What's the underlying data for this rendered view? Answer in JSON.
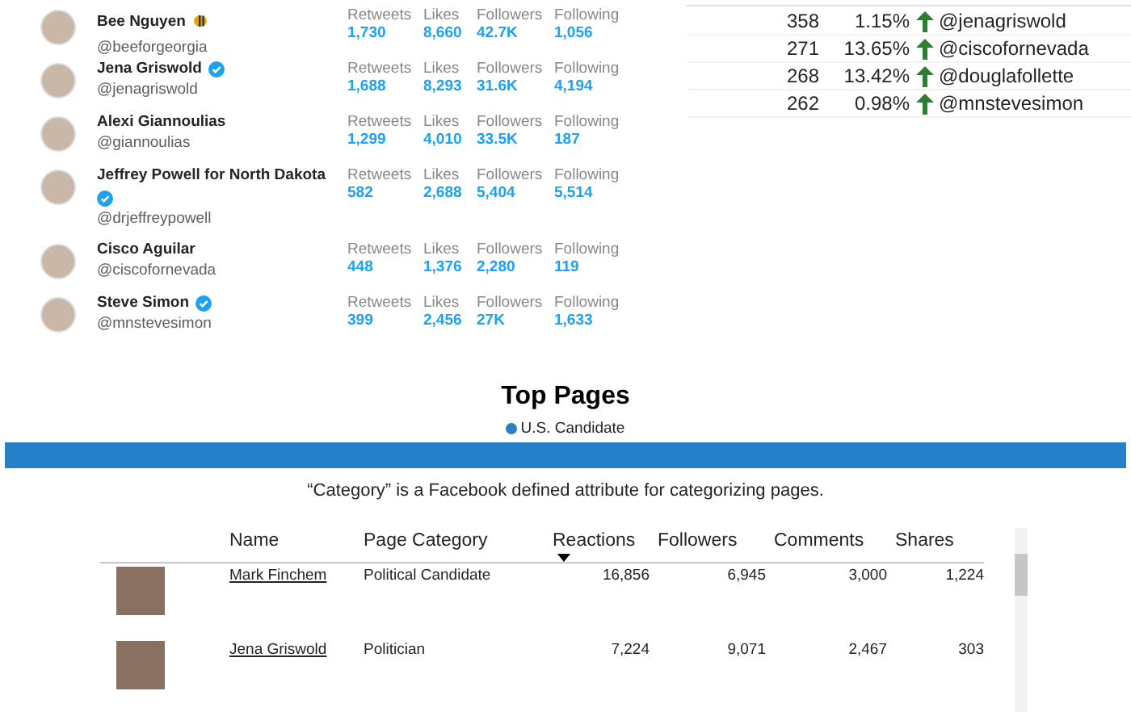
{
  "accounts": [
    {
      "name": "Bee Nguyen",
      "handle": "@beeforgeorgia",
      "verified": false,
      "emoji": true,
      "stats": [
        {
          "label": "Retweets",
          "value": "1,730"
        },
        {
          "label": "Likes",
          "value": "8,660"
        },
        {
          "label": "Followers",
          "value": "42.7K"
        },
        {
          "label": "Following",
          "value": "1,056"
        }
      ]
    },
    {
      "name": "Jena Griswold",
      "handle": "@jenagriswold",
      "verified": true,
      "emoji": false,
      "stats": [
        {
          "label": "Retweets",
          "value": "1,688"
        },
        {
          "label": "Likes",
          "value": "8,293"
        },
        {
          "label": "Followers",
          "value": "31.6K"
        },
        {
          "label": "Following",
          "value": "4,194"
        }
      ]
    },
    {
      "name": "Alexi Giannoulias",
      "handle": "@giannoulias",
      "verified": false,
      "emoji": false,
      "stats": [
        {
          "label": "Retweets",
          "value": "1,299"
        },
        {
          "label": "Likes",
          "value": "4,010"
        },
        {
          "label": "Followers",
          "value": "33.5K"
        },
        {
          "label": "Following",
          "value": "187"
        }
      ]
    },
    {
      "name": "Jeffrey Powell for North Dakota",
      "handle": "@drjeffreypowell",
      "verified": true,
      "emoji": false,
      "stats": [
        {
          "label": "Retweets",
          "value": "582"
        },
        {
          "label": "Likes",
          "value": "2,688"
        },
        {
          "label": "Followers",
          "value": "5,404"
        },
        {
          "label": "Following",
          "value": "5,514"
        }
      ]
    },
    {
      "name": "Cisco Aguilar",
      "handle": "@ciscofornevada",
      "verified": false,
      "emoji": false,
      "stats": [
        {
          "label": "Retweets",
          "value": "448"
        },
        {
          "label": "Likes",
          "value": "1,376"
        },
        {
          "label": "Followers",
          "value": "2,280"
        },
        {
          "label": "Following",
          "value": "119"
        }
      ]
    },
    {
      "name": "Steve Simon",
      "handle": "@mnstevesimon",
      "verified": true,
      "emoji": false,
      "stats": [
        {
          "label": "Retweets",
          "value": "399"
        },
        {
          "label": "Likes",
          "value": "2,456"
        },
        {
          "label": "Followers",
          "value": "27K"
        },
        {
          "label": "Following",
          "value": "1,633"
        }
      ]
    }
  ],
  "growth_table": {
    "rows": [
      {
        "count": "358",
        "change": "1.15%",
        "handle": "@jenagriswold"
      },
      {
        "count": "271",
        "change": "13.65%",
        "handle": "@ciscofornevada"
      },
      {
        "count": "268",
        "change": "13.42%",
        "handle": "@douglafollette"
      },
      {
        "count": "262",
        "change": "0.98%",
        "handle": "@mnstevesimon"
      }
    ]
  },
  "top_pages": {
    "title": "Top Pages",
    "legend": {
      "label": "U.S. Candidate",
      "color": "#2680c8"
    },
    "note": "“Category” is a Facebook defined attribute for categorizing pages.",
    "table": {
      "columns": [
        {
          "label": "Name",
          "sorted": false
        },
        {
          "label": "Page Category",
          "sorted": false
        },
        {
          "label": "Reactions",
          "sorted": true
        },
        {
          "label": "Followers",
          "sorted": false
        },
        {
          "label": "Comments",
          "sorted": false
        },
        {
          "label": "Shares",
          "sorted": false
        }
      ],
      "rows": [
        {
          "name": "Mark Finchem",
          "category": "Political Candidate",
          "reactions": "16,856",
          "followers": "6,945",
          "comments": "3,000",
          "shares": "1,224"
        },
        {
          "name": "Jena Griswold",
          "category": "Politician",
          "reactions": "7,224",
          "followers": "9,071",
          "comments": "2,467",
          "shares": "303"
        }
      ]
    }
  }
}
